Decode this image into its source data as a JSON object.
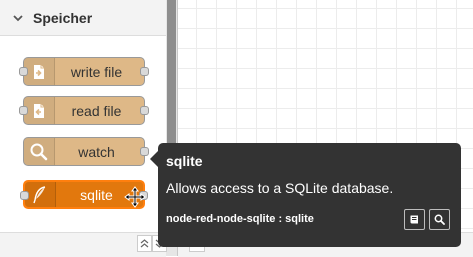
{
  "palette": {
    "category_title": "Speicher",
    "nodes": [
      {
        "label": "write file",
        "icon": "file-out-icon"
      },
      {
        "label": "read file",
        "icon": "file-in-icon"
      },
      {
        "label": "watch",
        "icon": "magnifier-icon"
      },
      {
        "label": "sqlite",
        "icon": "feather-icon"
      }
    ]
  },
  "tooltip": {
    "title": "sqlite",
    "description": "Allows access to a SQLite database.",
    "module": "node-red-node-sqlite : sqlite",
    "buttons": [
      "book-icon",
      "search-icon"
    ]
  },
  "colors": {
    "storage_node": "#deb887",
    "selected_node": "#e2780d",
    "tooltip_bg": "#333333"
  }
}
